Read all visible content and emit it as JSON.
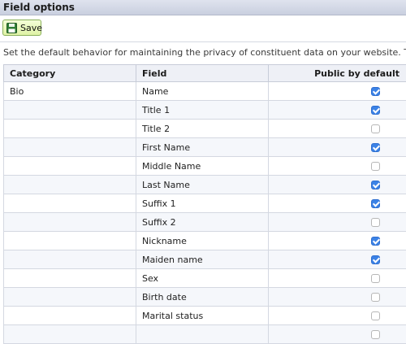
{
  "title": "Field options",
  "toolbar": {
    "save_label": "Save"
  },
  "description": "Set the default behavior for maintaining the privacy of constituent data on your website. These settings",
  "table": {
    "headers": {
      "category": "Category",
      "field": "Field",
      "public": "Public by default"
    },
    "rows": [
      {
        "category": "Bio",
        "field": "Name",
        "public": true
      },
      {
        "category": "",
        "field": "Title 1",
        "public": true
      },
      {
        "category": "",
        "field": "Title 2",
        "public": false
      },
      {
        "category": "",
        "field": "First Name",
        "public": true
      },
      {
        "category": "",
        "field": "Middle Name",
        "public": false
      },
      {
        "category": "",
        "field": "Last Name",
        "public": true
      },
      {
        "category": "",
        "field": "Suffix 1",
        "public": true
      },
      {
        "category": "",
        "field": "Suffix 2",
        "public": false
      },
      {
        "category": "",
        "field": "Nickname",
        "public": true
      },
      {
        "category": "",
        "field": "Maiden name",
        "public": true
      },
      {
        "category": "",
        "field": "Sex",
        "public": false
      },
      {
        "category": "",
        "field": "Birth date",
        "public": false
      },
      {
        "category": "",
        "field": "Marital status",
        "public": false
      },
      {
        "category": "",
        "field": "",
        "public": false
      }
    ]
  },
  "colors": {
    "accent": "#3b82e6",
    "save_button": "#dff2a6",
    "title_bar": "#c9cfdf"
  },
  "icons": {
    "save": "floppy-disk-icon"
  }
}
